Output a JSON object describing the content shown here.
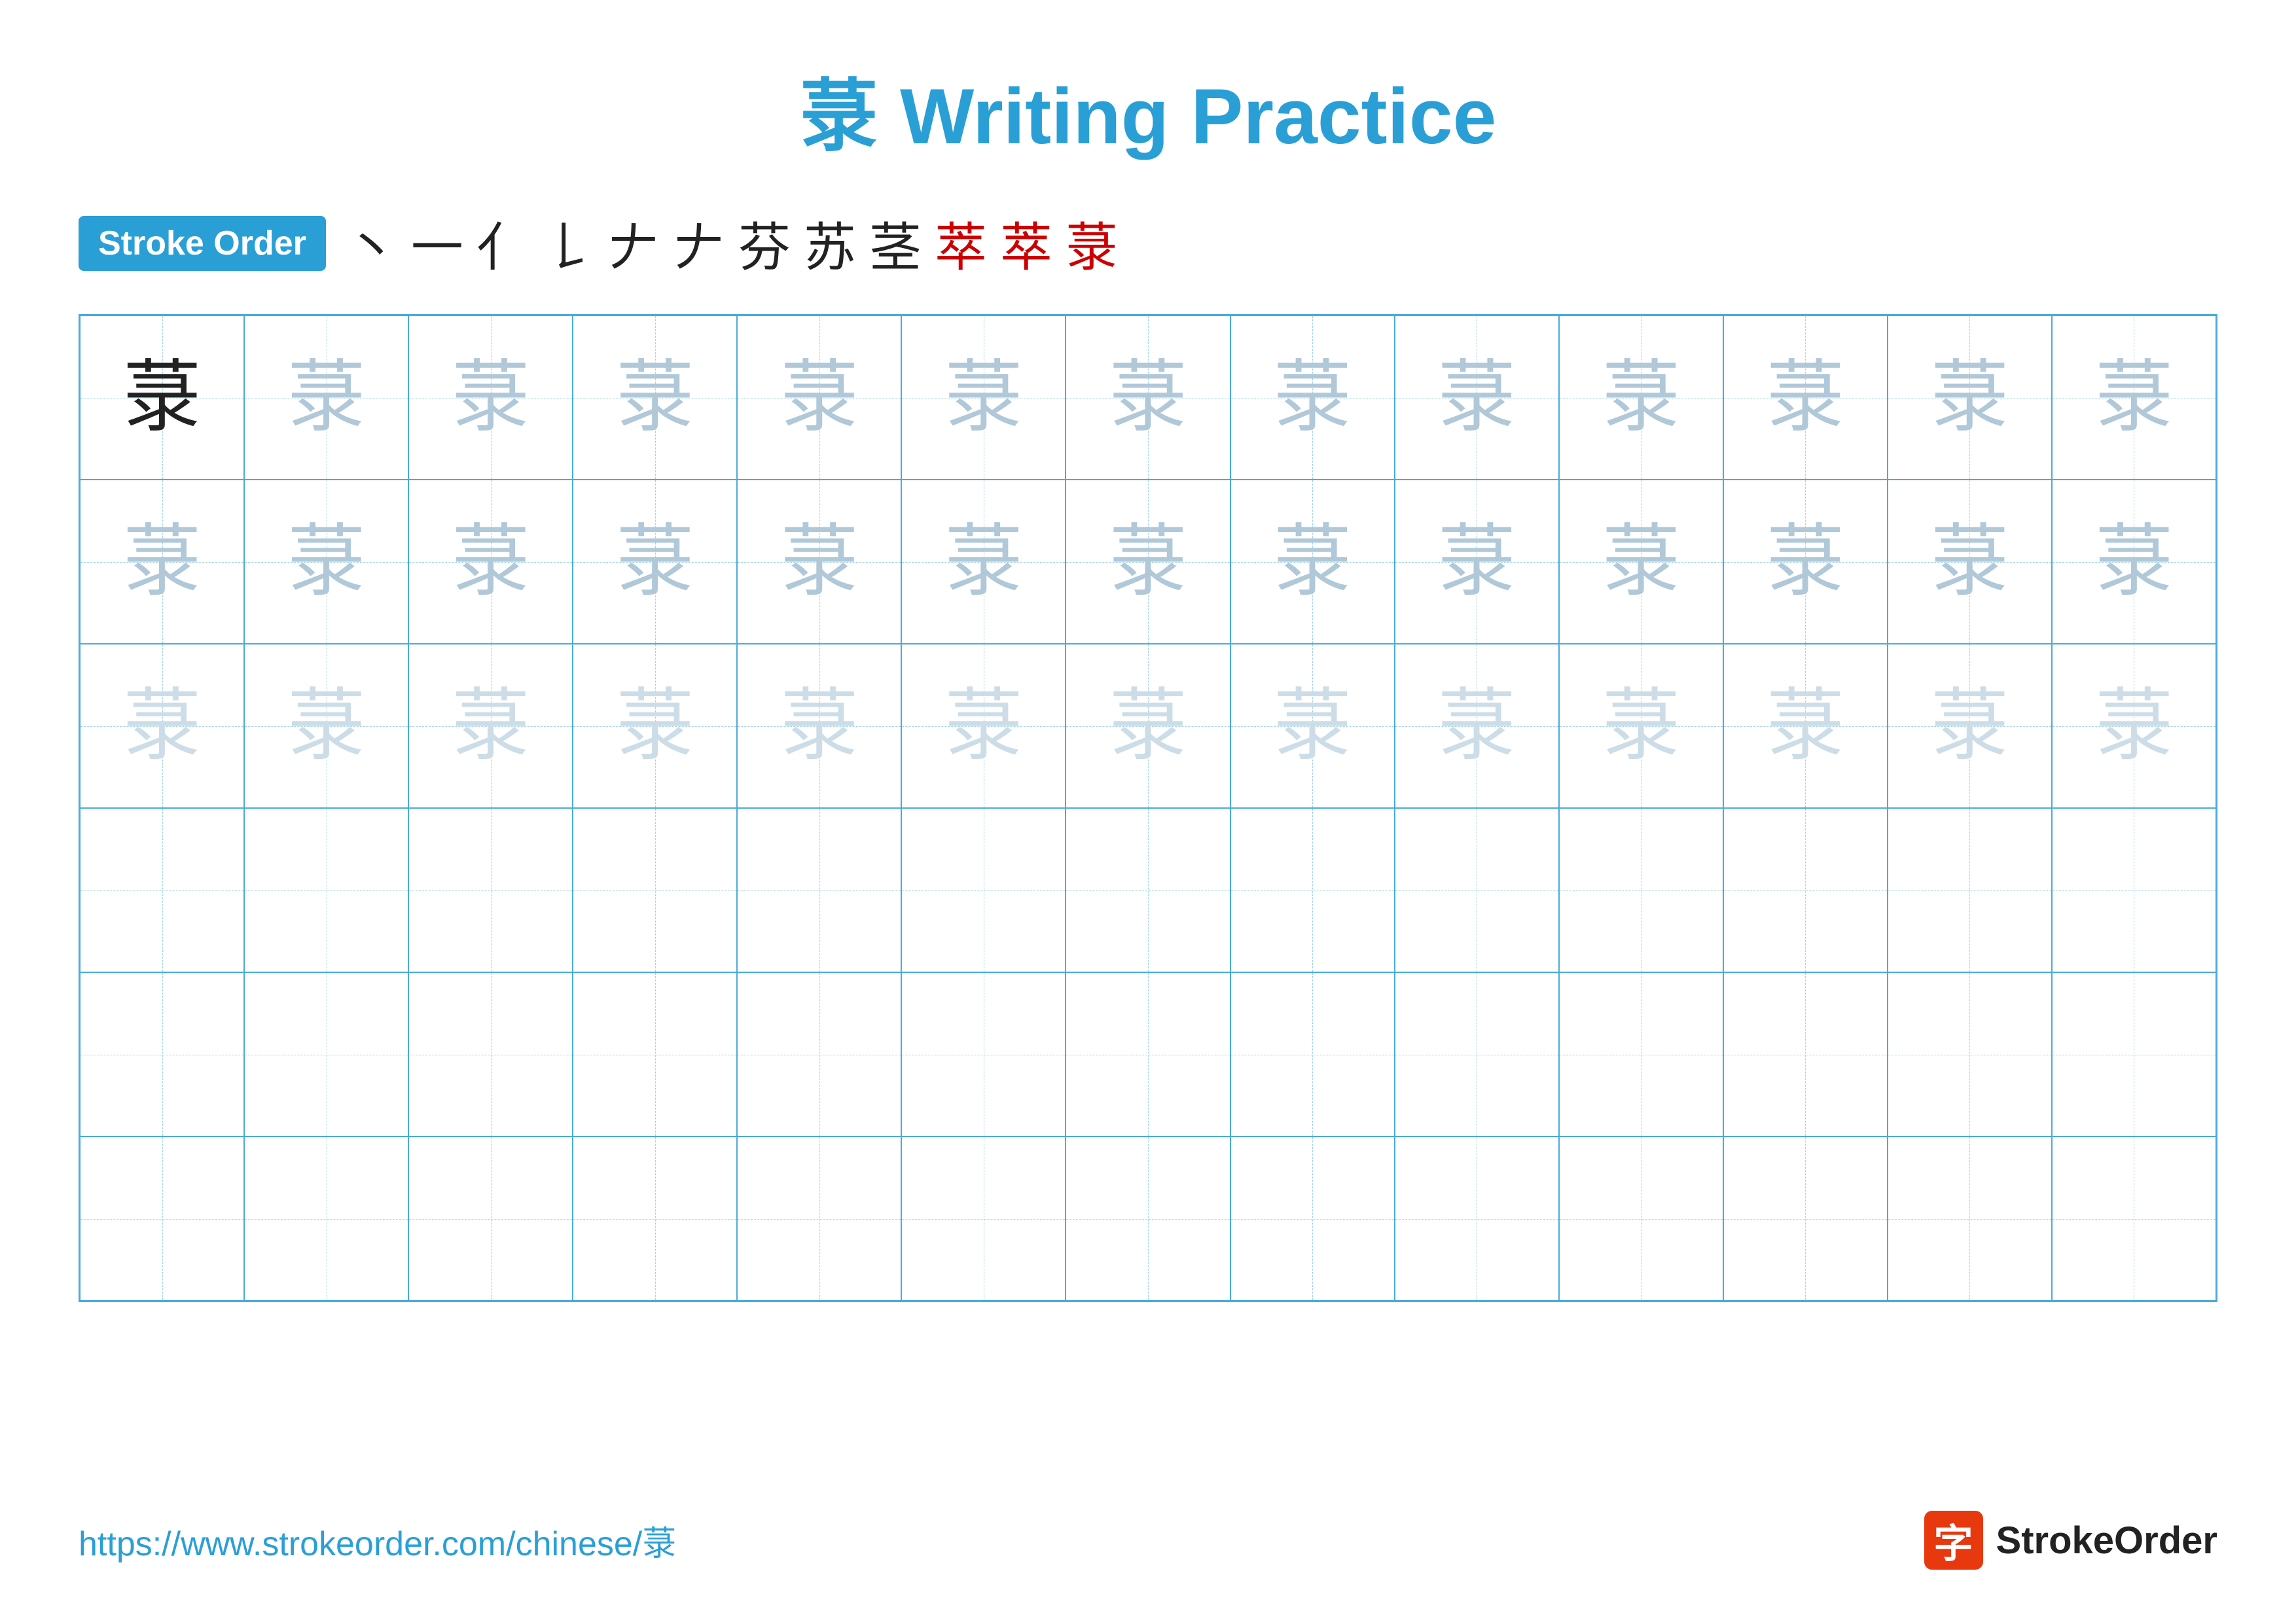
{
  "title": {
    "char": "菉",
    "text": " Writing Practice"
  },
  "stroke_order": {
    "badge_label": "Stroke Order",
    "strokes": [
      "丶",
      "一",
      "𠃋",
      "𠄌",
      "丬",
      "𠂇",
      "芬",
      "苏",
      "茎",
      "萃",
      "萃",
      "菉"
    ]
  },
  "grid": {
    "columns": 13,
    "rows": 6,
    "char": "菉",
    "row_styles": [
      "dark",
      "medium-gray",
      "light-gray",
      "very-light",
      "empty",
      "empty",
      "empty"
    ]
  },
  "footer": {
    "url": "https://www.strokeorder.com/chinese/菉",
    "logo_char": "字",
    "logo_text": "StrokeOrder"
  }
}
